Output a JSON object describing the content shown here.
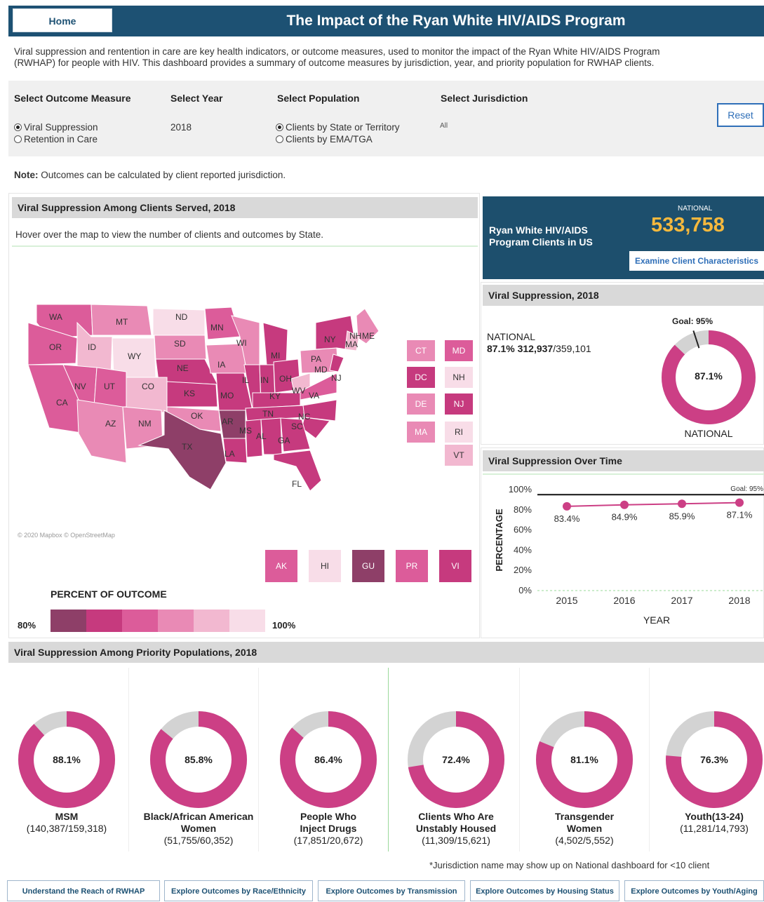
{
  "header": {
    "home_label": "Home",
    "title": "The Impact of the Ryan White HIV/AIDS Program"
  },
  "intro": {
    "line1": "Viral suppression and rentention in care are key health indicators, or outcome measures, used to monitor the impact of the Ryan White HIV/AIDS Program",
    "line2": "(RWHAP) for people with HIV. This dashboard provides a summary of outcome measures by jurisdiction, year, and priority population for RWHAP clients."
  },
  "controls": {
    "outcome_label": "Select Outcome Measure",
    "outcome_options": [
      "Viral Suppression",
      "Retention in Care"
    ],
    "year_label": "Select Year",
    "year_value": "2018",
    "population_label": "Select Population",
    "population_options": [
      "Clients by State or Territory",
      "Clients by EMA/TGA"
    ],
    "jurisdiction_label": "Select Jurisdiction",
    "jurisdiction_value": "All",
    "reset_label": "Reset"
  },
  "note": {
    "bold": "Note:",
    "text": " Outcomes can be calculated by client reported jurisdiction."
  },
  "map_panel": {
    "title": "Viral Suppression Among Clients Served, 2018",
    "hint": "Hover over the map to view the number of clients and outcomes by State.",
    "attribution": "© 2020 Mapbox © OpenStreetMap",
    "legend_title": "PERCENT OF OUTCOME",
    "legend_min": "80%",
    "legend_max": "100%",
    "legend_colors": [
      "#8e3f68",
      "#c63a7e",
      "#dc5c9a",
      "#e98ab5",
      "#f2b8d0",
      "#f8dde8"
    ],
    "small_states": [
      {
        "abbr": "CT",
        "color": "#e98ab5"
      },
      {
        "abbr": "MD",
        "color": "#dc5c9a"
      },
      {
        "abbr": "DC",
        "color": "#c63a7e"
      },
      {
        "abbr": "NH",
        "color": "#f8dde8"
      },
      {
        "abbr": "DE",
        "color": "#e98ab5"
      },
      {
        "abbr": "NJ",
        "color": "#c63a7e"
      },
      {
        "abbr": "MA",
        "color": "#e98ab5"
      },
      {
        "abbr": "RI",
        "color": "#f8dde8"
      },
      {
        "abbr": "VT",
        "color": "#f2b8d0"
      }
    ],
    "territories": [
      {
        "abbr": "AK",
        "color": "#dc5c9a"
      },
      {
        "abbr": "HI",
        "color": "#f8dde8"
      },
      {
        "abbr": "GU",
        "color": "#8e3f68"
      },
      {
        "abbr": "PR",
        "color": "#dc5c9a"
      },
      {
        "abbr": "VI",
        "color": "#c63a7e"
      }
    ],
    "state_labels": [
      "WA",
      "MT",
      "ND",
      "MN",
      "ME",
      "OR",
      "ID",
      "SD",
      "WI",
      "NY",
      "NH",
      "MA",
      "WY",
      "NE",
      "IA",
      "MI",
      "PA",
      "NV",
      "UT",
      "CO",
      "KS",
      "MO",
      "IL",
      "IN",
      "OH",
      "MD",
      "NJ",
      "WV",
      "VA",
      "KY",
      "CA",
      "AZ",
      "NM",
      "OK",
      "AR",
      "TN",
      "NC",
      "SC",
      "MS",
      "AL",
      "GA",
      "TX",
      "LA",
      "FL"
    ]
  },
  "national": {
    "heading": "Ryan White HIV/AIDS Program Clients in US",
    "label": "NATIONAL",
    "value": "533,758",
    "link": "Examine Client Characteristics"
  },
  "vs_panel": {
    "title": "Viral Suppression, 2018",
    "label": "NATIONAL",
    "pct": "87.1%",
    "fraction_bold": "312,937",
    "fraction_rest": "/359,101",
    "goal": "Goal: 95%",
    "donut_value": "87.1%",
    "donut_caption": "NATIONAL",
    "percent": 87.1
  },
  "trend_panel": {
    "title": "Viral Suppression Over Time",
    "ylabel": "PERCENTAGE",
    "xlabel": "YEAR",
    "goal_label": "Goal: 95%"
  },
  "chart_data": {
    "type": "line",
    "title": "Viral Suppression Over Time",
    "x": [
      "2015",
      "2016",
      "2017",
      "2018"
    ],
    "series": [
      {
        "values": [
          83.4,
          84.9,
          85.9,
          87.1
        ]
      }
    ],
    "data_labels": [
      "83.4%",
      "84.9%",
      "85.9%",
      "87.1%"
    ],
    "xlabel": "YEAR",
    "ylabel": "PERCENTAGE",
    "ylim": [
      0,
      100
    ],
    "yticks": [
      "100%",
      "80%",
      "60%",
      "40%",
      "20%",
      "0%"
    ],
    "goal": 95,
    "grid": false
  },
  "priority": {
    "title": "Viral Suppression Among Priority Populations, 2018",
    "items": [
      {
        "pct": "88.1%",
        "value": 88.1,
        "name1": "MSM",
        "name2": "",
        "counts": "(140,387/159,318)"
      },
      {
        "pct": "85.8%",
        "value": 85.8,
        "name1": "Black/African American",
        "name2": "Women",
        "counts": "(51,755/60,352)"
      },
      {
        "pct": "86.4%",
        "value": 86.4,
        "name1": "People Who",
        "name2": "Inject Drugs",
        "counts": "(17,851/20,672)"
      },
      {
        "pct": "72.4%",
        "value": 72.4,
        "name1": "Clients Who Are",
        "name2": "Unstably Housed",
        "counts": "(11,309/15,621)"
      },
      {
        "pct": "81.1%",
        "value": 81.1,
        "name1": "Transgender",
        "name2": "Women",
        "counts": "(4,502/5,552)"
      },
      {
        "pct": "76.3%",
        "value": 76.3,
        "name1": "Youth(13-24)",
        "name2": "",
        "counts": "(11,281/14,793)"
      }
    ]
  },
  "footnote": "*Jurisdiction name may show up on National dashboard for <10 client",
  "bottom_buttons": [
    "Understand the Reach of RWHAP",
    "Explore Outcomes by Race/Ethnicity",
    "Explore Outcomes by Transmission",
    "Explore Outcomes by Housing Status",
    "Explore Outcomes by Youth/Aging"
  ],
  "colors": {
    "brand": "#1d5173",
    "accent": "#cc3f85",
    "national_value": "#f5b83d"
  }
}
